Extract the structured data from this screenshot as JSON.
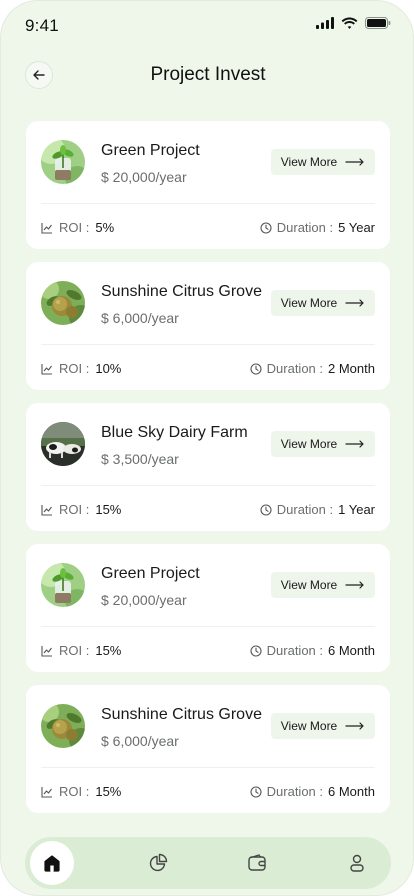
{
  "status_bar": {
    "time": "9:41"
  },
  "header": {
    "title": "Project Invest"
  },
  "projects": [
    {
      "name": "Green Project",
      "price": "$ 20,000/year",
      "roi_label": "ROI :",
      "roi": "5%",
      "duration_label": "Duration :",
      "duration": "5 Year",
      "image": "sapling-jar"
    },
    {
      "name": "Sunshine Citrus Grove",
      "price": "$ 6,000/year",
      "roi_label": "ROI :",
      "roi": "10%",
      "duration_label": "Duration :",
      "duration": "2 Month",
      "image": "citrus"
    },
    {
      "name": "Blue Sky Dairy Farm",
      "price": "$ 3,500/year",
      "roi_label": "ROI :",
      "roi": "15%",
      "duration_label": "Duration :",
      "duration": "1 Year",
      "image": "dairy-cows"
    },
    {
      "name": "Green Project",
      "price": "$ 20,000/year",
      "roi_label": "ROI :",
      "roi": "15%",
      "duration_label": "Duration :",
      "duration": "6 Month",
      "image": "sapling-jar"
    },
    {
      "name": "Sunshine Citrus Grove",
      "price": "$ 6,000/year",
      "roi_label": "ROI :",
      "roi": "15%",
      "duration_label": "Duration :",
      "duration": "6 Month",
      "image": "citrus"
    }
  ],
  "view_more_label": "View More",
  "bottom_nav": [
    {
      "icon": "home-icon",
      "active": true
    },
    {
      "icon": "pie-chart-icon",
      "active": false
    },
    {
      "icon": "wallet-icon",
      "active": false
    },
    {
      "icon": "profile-icon",
      "active": false
    }
  ],
  "colors": {
    "background": "#eef7ea",
    "card": "#ffffff",
    "nav": "#dbecd4",
    "button": "#eef5eb"
  }
}
